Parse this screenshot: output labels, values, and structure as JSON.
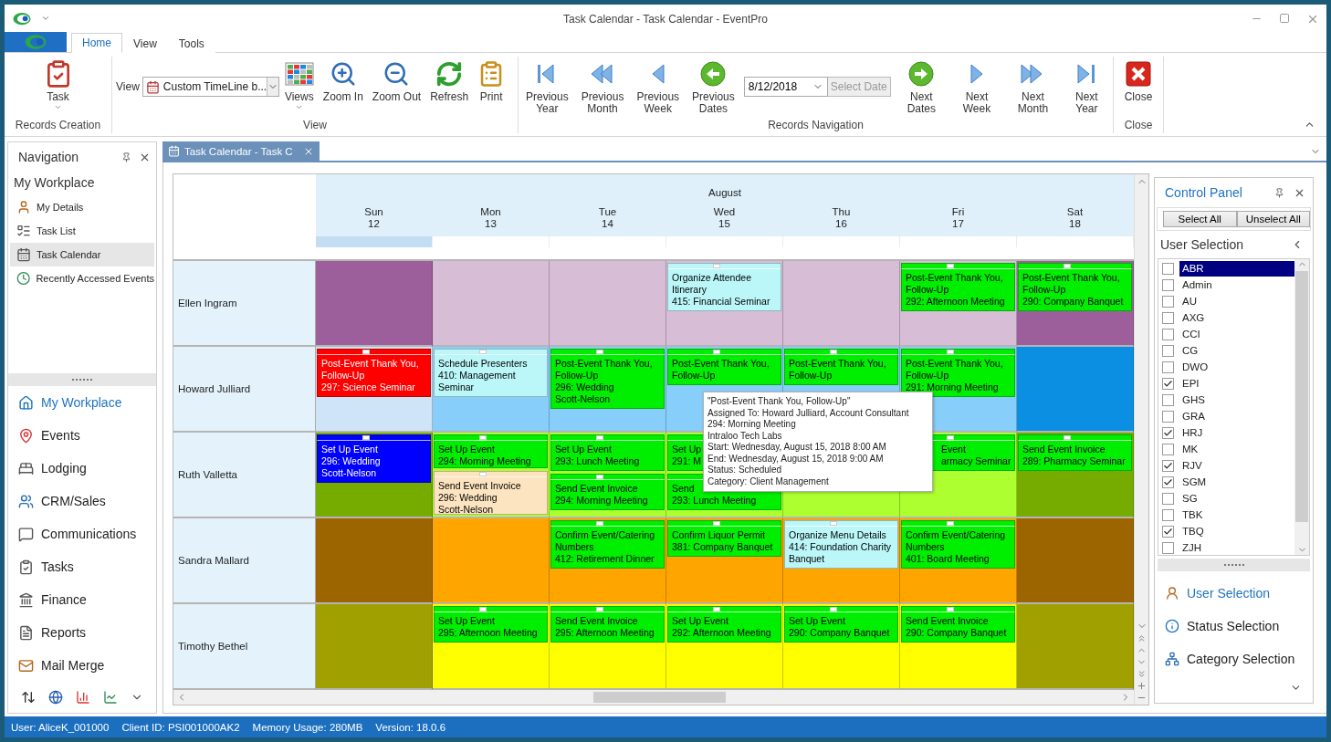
{
  "window": {
    "title": "Task Calendar - Task Calendar - EventPro"
  },
  "ribbon_tabs": [
    {
      "label": "Home",
      "selected": true
    },
    {
      "label": "View",
      "selected": false
    },
    {
      "label": "Tools",
      "selected": false
    }
  ],
  "ribbon_groups": [
    {
      "title": "Records Creation",
      "items": [
        {
          "kind": "big",
          "label": "Task",
          "dropdown": true
        }
      ]
    },
    {
      "title": "View",
      "items": [
        {
          "kind": "combo",
          "label": "View",
          "value": "Custom TimeLine b..."
        },
        {
          "kind": "big",
          "label": "Views",
          "dropdown": true
        },
        {
          "kind": "big",
          "label": "Zoom In",
          "dropdown": false
        },
        {
          "kind": "big",
          "label": "Zoom Out",
          "dropdown": false
        },
        {
          "kind": "big",
          "label": "Refresh",
          "dropdown": false
        },
        {
          "kind": "big",
          "label": "Print",
          "dropdown": false
        }
      ]
    },
    {
      "title": "Records Navigation",
      "items": [
        {
          "kind": "big",
          "label": "Previous\nYear",
          "dropdown": false
        },
        {
          "kind": "big",
          "label": "Previous\nMonth",
          "dropdown": false
        },
        {
          "kind": "big",
          "label": "Previous\nWeek",
          "dropdown": false
        },
        {
          "kind": "big",
          "label": "Previous\nDates",
          "dropdown": false
        },
        {
          "kind": "date",
          "value": "8/12/2018",
          "button": "Select Date",
          "disabled": true
        },
        {
          "kind": "big",
          "label": "Next Dates",
          "dropdown": false
        },
        {
          "kind": "big",
          "label": "Next Week",
          "dropdown": false
        },
        {
          "kind": "big",
          "label": "Next Month",
          "dropdown": false
        },
        {
          "kind": "big",
          "label": "Next Year",
          "dropdown": false
        }
      ]
    },
    {
      "title": "Close",
      "items": [
        {
          "kind": "big",
          "label": "Close",
          "dropdown": false
        }
      ]
    }
  ],
  "navigation": {
    "title": "Navigation",
    "section": "My Workplace",
    "items": [
      {
        "label": "My Details",
        "selected": false
      },
      {
        "label": "Task List",
        "selected": false
      },
      {
        "label": "Task Calendar",
        "selected": true
      },
      {
        "label": "Recently Accessed Events",
        "selected": false
      }
    ],
    "modules": [
      {
        "label": "My Workplace",
        "selected": true
      },
      {
        "label": "Events",
        "selected": false
      },
      {
        "label": "Lodging",
        "selected": false
      },
      {
        "label": "CRM/Sales",
        "selected": false
      },
      {
        "label": "Communications",
        "selected": false
      },
      {
        "label": "Tasks",
        "selected": false
      },
      {
        "label": "Finance",
        "selected": false
      },
      {
        "label": "Reports",
        "selected": false
      },
      {
        "label": "Mail Merge",
        "selected": false
      }
    ]
  },
  "document_tab": {
    "label": "Task Calendar - Task C"
  },
  "calendar": {
    "month": "August",
    "days": [
      {
        "dow": "Sun",
        "date": "12",
        "selected": true
      },
      {
        "dow": "Mon",
        "date": "13",
        "selected": false
      },
      {
        "dow": "Tue",
        "date": "14",
        "selected": false
      },
      {
        "dow": "Wed",
        "date": "15",
        "selected": false
      },
      {
        "dow": "Thu",
        "date": "16",
        "selected": false
      },
      {
        "dow": "Fri",
        "date": "17",
        "selected": false
      },
      {
        "dow": "Sat",
        "date": "18",
        "selected": false
      }
    ],
    "resources": [
      {
        "name": "Ellen Ingram",
        "cells": [
          {
            "color": "#9c5f9c"
          },
          {
            "color": "#d7bdd6"
          },
          {
            "color": "#d7bdd6"
          },
          {
            "color": "#d7bdd6",
            "events": [
              {
                "text": "Organize Attendee\nItinerary\n415: Financial Seminar",
                "color": "#bbf7f9",
                "covered_left": false
              }
            ]
          },
          {
            "color": "#d7bdd6"
          },
          {
            "color": "#d7bdd6",
            "events": [
              {
                "text": "Post-Event Thank You,\nFollow-Up\n292: Afternoon Meeting",
                "color": "#00ee00",
                "covered_left": false
              }
            ]
          },
          {
            "color": "#9c5f9c",
            "events": [
              {
                "text": "Post-Event Thank You,\nFollow-Up\n290: Company Banquet",
                "color": "#00ee00",
                "covered_left": false
              }
            ]
          }
        ]
      },
      {
        "name": "Howard Julliard",
        "cells": [
          {
            "color": "#cfe4f6",
            "events": [
              {
                "text": "Post-Event Thank You,\nFollow-Up\n297: Science Seminar",
                "color": "#ff0000",
                "covered_left": false
              }
            ]
          },
          {
            "color": "#87cefa",
            "events": [
              {
                "text": "Schedule Presenters\n410: Management\nSeminar",
                "color": "#bbf7f9",
                "covered_left": false
              }
            ]
          },
          {
            "color": "#87cefa",
            "events": [
              {
                "text": "Post-Event Thank You,\nFollow-Up\n296: Wedding\nScott-Nelson",
                "color": "#00ee00",
                "covered_left": false
              }
            ]
          },
          {
            "color": "#87cefa",
            "events": [
              {
                "text": "Post-Event Thank You,\nFollow-Up",
                "color": "#00ee00",
                "covered_left": false
              }
            ]
          },
          {
            "color": "#87cefa",
            "events": [
              {
                "text": "Post-Event Thank You,\nFollow-Up",
                "color": "#00ee00",
                "covered_left": false
              }
            ]
          },
          {
            "color": "#87cefa",
            "events": [
              {
                "text": "Post-Event Thank You,\nFollow-Up\n291: Morning Meeting",
                "color": "#00ee00",
                "covered_left": false
              }
            ]
          },
          {
            "color": "#0b8fe2"
          }
        ]
      },
      {
        "name": "Ruth Valletta",
        "cells": [
          {
            "color": "#76ab00",
            "events": [
              {
                "text": "Set Up Event\n296: Wedding\nScott-Nelson",
                "color": "#0000ff",
                "covered_left": false
              }
            ]
          },
          {
            "color": "#adff2f",
            "events": [
              {
                "text": "Set Up Event\n294: Morning Meeting",
                "color": "#00ee00",
                "covered_left": false
              },
              {
                "text": "Send Event Invoice\n296: Wedding\nScott-Nelson",
                "color": "#fde4c0",
                "covered_left": false
              }
            ]
          },
          {
            "color": "#adff2f",
            "events": [
              {
                "text": "Set Up Event\n293: Lunch Meeting",
                "color": "#00ee00",
                "covered_left": false
              },
              {
                "text": "Send Event Invoice\n294: Morning Meeting",
                "color": "#00ee00",
                "covered_left": false
              }
            ]
          },
          {
            "color": "#adff2f",
            "events": [
              {
                "text": "Set Up\n291: M",
                "color": "#00ee00",
                "covered_left": false
              },
              {
                "text": "Send\n293: Lunch Meeting",
                "color": "#00ee00",
                "covered_left": false
              }
            ]
          },
          {
            "color": "#adff2f"
          },
          {
            "color": "#adff2f",
            "events": [
              {
                "text": "Event\narmacy Seminar",
                "color": "#00ee00",
                "covered_left": true
              }
            ]
          },
          {
            "color": "#76ab00",
            "events": [
              {
                "text": "Send Event Invoice\n289: Pharmacy Seminar",
                "color": "#00ee00",
                "covered_left": false
              }
            ]
          }
        ]
      },
      {
        "name": "Sandra Mallard",
        "cells": [
          {
            "color": "#9c6500"
          },
          {
            "color": "#ffa500"
          },
          {
            "color": "#ffa500",
            "events": [
              {
                "text": "Confirm Event/Catering\nNumbers\n412: Retirement Dinner",
                "color": "#00ee00",
                "covered_left": false
              }
            ]
          },
          {
            "color": "#ffa500",
            "events": [
              {
                "text": "Confirm Liquor Permit\n381: Company Banquet",
                "color": "#00ee00",
                "covered_left": false
              }
            ]
          },
          {
            "color": "#ffa500",
            "events": [
              {
                "text": "Organize Menu Details\n414: Foundation Charity\nBanquet",
                "color": "#bbf7f9",
                "covered_left": false
              }
            ]
          },
          {
            "color": "#ffa500",
            "events": [
              {
                "text": "Confirm Event/Catering\nNumbers\n401: Board Meeting",
                "color": "#00ee00",
                "covered_left": false
              }
            ]
          },
          {
            "color": "#9c6500"
          }
        ]
      },
      {
        "name": "Timothy Bethel",
        "cells": [
          {
            "color": "#a0a000"
          },
          {
            "color": "#ffff00",
            "events": [
              {
                "text": "Set Up Event\n295: Afternoon Meeting",
                "color": "#00ee00",
                "covered_left": false
              }
            ]
          },
          {
            "color": "#ffff00",
            "events": [
              {
                "text": "Send Event Invoice\n295: Afternoon Meeting",
                "color": "#00ee00",
                "covered_left": false
              }
            ]
          },
          {
            "color": "#ffff00",
            "events": [
              {
                "text": "Set Up Event\n292: Afternoon Meeting",
                "color": "#00ee00",
                "covered_left": false
              }
            ]
          },
          {
            "color": "#ffff00",
            "events": [
              {
                "text": "Set Up Event\n290: Company Banquet",
                "color": "#00ee00",
                "covered_left": false
              }
            ]
          },
          {
            "color": "#ffff00",
            "events": [
              {
                "text": "Send Event Invoice\n290: Company Banquet",
                "color": "#00ee00",
                "covered_left": false
              }
            ]
          },
          {
            "color": "#a0a000"
          }
        ]
      }
    ],
    "tooltip": [
      "\"Post-Event Thank You, Follow-Up\"",
      "Assigned To: Howard Julliard, Account Consultant",
      "294: Morning Meeting",
      "Intraloo Tech Labs",
      "Start: Wednesday, August 15, 2018 8:00 AM",
      "End: Wednesday, August 15, 2018 9:00 AM",
      "Status: Scheduled",
      "Category: Client Management"
    ]
  },
  "control_panel": {
    "title": "Control Panel",
    "buttons": [
      "Select All",
      "Unselect All"
    ],
    "section": "User Selection",
    "users": [
      {
        "label": "ABR",
        "checked": false,
        "selected": true
      },
      {
        "label": "Admin",
        "checked": false,
        "selected": false
      },
      {
        "label": "AU",
        "checked": false,
        "selected": false
      },
      {
        "label": "AXG",
        "checked": false,
        "selected": false
      },
      {
        "label": "CCI",
        "checked": false,
        "selected": false
      },
      {
        "label": "CG",
        "checked": false,
        "selected": false
      },
      {
        "label": "DWO",
        "checked": false,
        "selected": false
      },
      {
        "label": "EPI",
        "checked": true,
        "selected": false
      },
      {
        "label": "GHS",
        "checked": false,
        "selected": false
      },
      {
        "label": "GRA",
        "checked": false,
        "selected": false
      },
      {
        "label": "HRJ",
        "checked": true,
        "selected": false
      },
      {
        "label": "MK",
        "checked": false,
        "selected": false
      },
      {
        "label": "RJV",
        "checked": true,
        "selected": false
      },
      {
        "label": "SGM",
        "checked": true,
        "selected": false
      },
      {
        "label": "SG",
        "checked": false,
        "selected": false
      },
      {
        "label": "TBK",
        "checked": false,
        "selected": false
      },
      {
        "label": "TBQ",
        "checked": true,
        "selected": false
      },
      {
        "label": "ZJH",
        "checked": false,
        "selected": false
      }
    ],
    "panels": [
      {
        "label": "User Selection",
        "selected": true
      },
      {
        "label": "Status Selection",
        "selected": false
      },
      {
        "label": "Category Selection",
        "selected": false
      }
    ]
  },
  "status_bar": [
    "User: AliceK_001000",
    "Client ID: PSI001000AK2",
    "Memory Usage: 280MB",
    "Version: 18.0.6"
  ]
}
